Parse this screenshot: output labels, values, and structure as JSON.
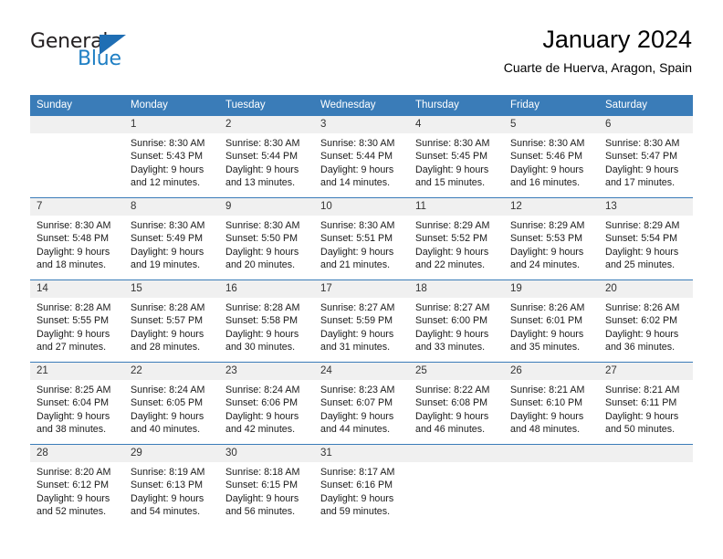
{
  "brand": {
    "name_top": "General",
    "name_bottom": "Blue",
    "accent_color": "#1f6eb4"
  },
  "header": {
    "month_title": "January 2024",
    "location": "Cuarte de Huerva, Aragon, Spain"
  },
  "calendar": {
    "header_bg": "#3a7cb8",
    "daynum_bg": "#f0f0f0",
    "weekday_headers": [
      "Sunday",
      "Monday",
      "Tuesday",
      "Wednesday",
      "Thursday",
      "Friday",
      "Saturday"
    ],
    "labels": {
      "sunrise_prefix": "Sunrise:",
      "sunset_prefix": "Sunset:",
      "daylight_prefix": "Daylight:"
    },
    "weeks": [
      [
        {
          "day": "",
          "sunrise": "",
          "sunset": "",
          "daylight_line1": "",
          "daylight_line2": ""
        },
        {
          "day": "1",
          "sunrise": "Sunrise: 8:30 AM",
          "sunset": "Sunset: 5:43 PM",
          "daylight_line1": "Daylight: 9 hours",
          "daylight_line2": "and 12 minutes."
        },
        {
          "day": "2",
          "sunrise": "Sunrise: 8:30 AM",
          "sunset": "Sunset: 5:44 PM",
          "daylight_line1": "Daylight: 9 hours",
          "daylight_line2": "and 13 minutes."
        },
        {
          "day": "3",
          "sunrise": "Sunrise: 8:30 AM",
          "sunset": "Sunset: 5:44 PM",
          "daylight_line1": "Daylight: 9 hours",
          "daylight_line2": "and 14 minutes."
        },
        {
          "day": "4",
          "sunrise": "Sunrise: 8:30 AM",
          "sunset": "Sunset: 5:45 PM",
          "daylight_line1": "Daylight: 9 hours",
          "daylight_line2": "and 15 minutes."
        },
        {
          "day": "5",
          "sunrise": "Sunrise: 8:30 AM",
          "sunset": "Sunset: 5:46 PM",
          "daylight_line1": "Daylight: 9 hours",
          "daylight_line2": "and 16 minutes."
        },
        {
          "day": "6",
          "sunrise": "Sunrise: 8:30 AM",
          "sunset": "Sunset: 5:47 PM",
          "daylight_line1": "Daylight: 9 hours",
          "daylight_line2": "and 17 minutes."
        }
      ],
      [
        {
          "day": "7",
          "sunrise": "Sunrise: 8:30 AM",
          "sunset": "Sunset: 5:48 PM",
          "daylight_line1": "Daylight: 9 hours",
          "daylight_line2": "and 18 minutes."
        },
        {
          "day": "8",
          "sunrise": "Sunrise: 8:30 AM",
          "sunset": "Sunset: 5:49 PM",
          "daylight_line1": "Daylight: 9 hours",
          "daylight_line2": "and 19 minutes."
        },
        {
          "day": "9",
          "sunrise": "Sunrise: 8:30 AM",
          "sunset": "Sunset: 5:50 PM",
          "daylight_line1": "Daylight: 9 hours",
          "daylight_line2": "and 20 minutes."
        },
        {
          "day": "10",
          "sunrise": "Sunrise: 8:30 AM",
          "sunset": "Sunset: 5:51 PM",
          "daylight_line1": "Daylight: 9 hours",
          "daylight_line2": "and 21 minutes."
        },
        {
          "day": "11",
          "sunrise": "Sunrise: 8:29 AM",
          "sunset": "Sunset: 5:52 PM",
          "daylight_line1": "Daylight: 9 hours",
          "daylight_line2": "and 22 minutes."
        },
        {
          "day": "12",
          "sunrise": "Sunrise: 8:29 AM",
          "sunset": "Sunset: 5:53 PM",
          "daylight_line1": "Daylight: 9 hours",
          "daylight_line2": "and 24 minutes."
        },
        {
          "day": "13",
          "sunrise": "Sunrise: 8:29 AM",
          "sunset": "Sunset: 5:54 PM",
          "daylight_line1": "Daylight: 9 hours",
          "daylight_line2": "and 25 minutes."
        }
      ],
      [
        {
          "day": "14",
          "sunrise": "Sunrise: 8:28 AM",
          "sunset": "Sunset: 5:55 PM",
          "daylight_line1": "Daylight: 9 hours",
          "daylight_line2": "and 27 minutes."
        },
        {
          "day": "15",
          "sunrise": "Sunrise: 8:28 AM",
          "sunset": "Sunset: 5:57 PM",
          "daylight_line1": "Daylight: 9 hours",
          "daylight_line2": "and 28 minutes."
        },
        {
          "day": "16",
          "sunrise": "Sunrise: 8:28 AM",
          "sunset": "Sunset: 5:58 PM",
          "daylight_line1": "Daylight: 9 hours",
          "daylight_line2": "and 30 minutes."
        },
        {
          "day": "17",
          "sunrise": "Sunrise: 8:27 AM",
          "sunset": "Sunset: 5:59 PM",
          "daylight_line1": "Daylight: 9 hours",
          "daylight_line2": "and 31 minutes."
        },
        {
          "day": "18",
          "sunrise": "Sunrise: 8:27 AM",
          "sunset": "Sunset: 6:00 PM",
          "daylight_line1": "Daylight: 9 hours",
          "daylight_line2": "and 33 minutes."
        },
        {
          "day": "19",
          "sunrise": "Sunrise: 8:26 AM",
          "sunset": "Sunset: 6:01 PM",
          "daylight_line1": "Daylight: 9 hours",
          "daylight_line2": "and 35 minutes."
        },
        {
          "day": "20",
          "sunrise": "Sunrise: 8:26 AM",
          "sunset": "Sunset: 6:02 PM",
          "daylight_line1": "Daylight: 9 hours",
          "daylight_line2": "and 36 minutes."
        }
      ],
      [
        {
          "day": "21",
          "sunrise": "Sunrise: 8:25 AM",
          "sunset": "Sunset: 6:04 PM",
          "daylight_line1": "Daylight: 9 hours",
          "daylight_line2": "and 38 minutes."
        },
        {
          "day": "22",
          "sunrise": "Sunrise: 8:24 AM",
          "sunset": "Sunset: 6:05 PM",
          "daylight_line1": "Daylight: 9 hours",
          "daylight_line2": "and 40 minutes."
        },
        {
          "day": "23",
          "sunrise": "Sunrise: 8:24 AM",
          "sunset": "Sunset: 6:06 PM",
          "daylight_line1": "Daylight: 9 hours",
          "daylight_line2": "and 42 minutes."
        },
        {
          "day": "24",
          "sunrise": "Sunrise: 8:23 AM",
          "sunset": "Sunset: 6:07 PM",
          "daylight_line1": "Daylight: 9 hours",
          "daylight_line2": "and 44 minutes."
        },
        {
          "day": "25",
          "sunrise": "Sunrise: 8:22 AM",
          "sunset": "Sunset: 6:08 PM",
          "daylight_line1": "Daylight: 9 hours",
          "daylight_line2": "and 46 minutes."
        },
        {
          "day": "26",
          "sunrise": "Sunrise: 8:21 AM",
          "sunset": "Sunset: 6:10 PM",
          "daylight_line1": "Daylight: 9 hours",
          "daylight_line2": "and 48 minutes."
        },
        {
          "day": "27",
          "sunrise": "Sunrise: 8:21 AM",
          "sunset": "Sunset: 6:11 PM",
          "daylight_line1": "Daylight: 9 hours",
          "daylight_line2": "and 50 minutes."
        }
      ],
      [
        {
          "day": "28",
          "sunrise": "Sunrise: 8:20 AM",
          "sunset": "Sunset: 6:12 PM",
          "daylight_line1": "Daylight: 9 hours",
          "daylight_line2": "and 52 minutes."
        },
        {
          "day": "29",
          "sunrise": "Sunrise: 8:19 AM",
          "sunset": "Sunset: 6:13 PM",
          "daylight_line1": "Daylight: 9 hours",
          "daylight_line2": "and 54 minutes."
        },
        {
          "day": "30",
          "sunrise": "Sunrise: 8:18 AM",
          "sunset": "Sunset: 6:15 PM",
          "daylight_line1": "Daylight: 9 hours",
          "daylight_line2": "and 56 minutes."
        },
        {
          "day": "31",
          "sunrise": "Sunrise: 8:17 AM",
          "sunset": "Sunset: 6:16 PM",
          "daylight_line1": "Daylight: 9 hours",
          "daylight_line2": "and 59 minutes."
        },
        {
          "day": "",
          "sunrise": "",
          "sunset": "",
          "daylight_line1": "",
          "daylight_line2": ""
        },
        {
          "day": "",
          "sunrise": "",
          "sunset": "",
          "daylight_line1": "",
          "daylight_line2": ""
        },
        {
          "day": "",
          "sunrise": "",
          "sunset": "",
          "daylight_line1": "",
          "daylight_line2": ""
        }
      ]
    ]
  }
}
